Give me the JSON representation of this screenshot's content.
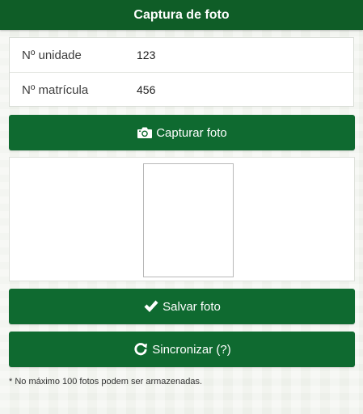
{
  "header": {
    "title": "Captura de foto"
  },
  "form": {
    "unit_label": "Nº unidade",
    "unit_value": "123",
    "registration_label": "Nº matrícula",
    "registration_value": "456"
  },
  "buttons": {
    "capture_label": "Capturar foto",
    "save_label": "Salvar foto",
    "sync_label": "Sincronizar (?)"
  },
  "icons": {
    "capture": "camera-icon",
    "save": "checkmark-icon",
    "sync": "refresh-icon"
  },
  "footer": {
    "note": "* No máximo 100 fotos podem ser armazenadas."
  },
  "colors": {
    "header_bg": "#0f5d27",
    "button_bg": "#0f6a30",
    "button_text": "#ffffff"
  }
}
